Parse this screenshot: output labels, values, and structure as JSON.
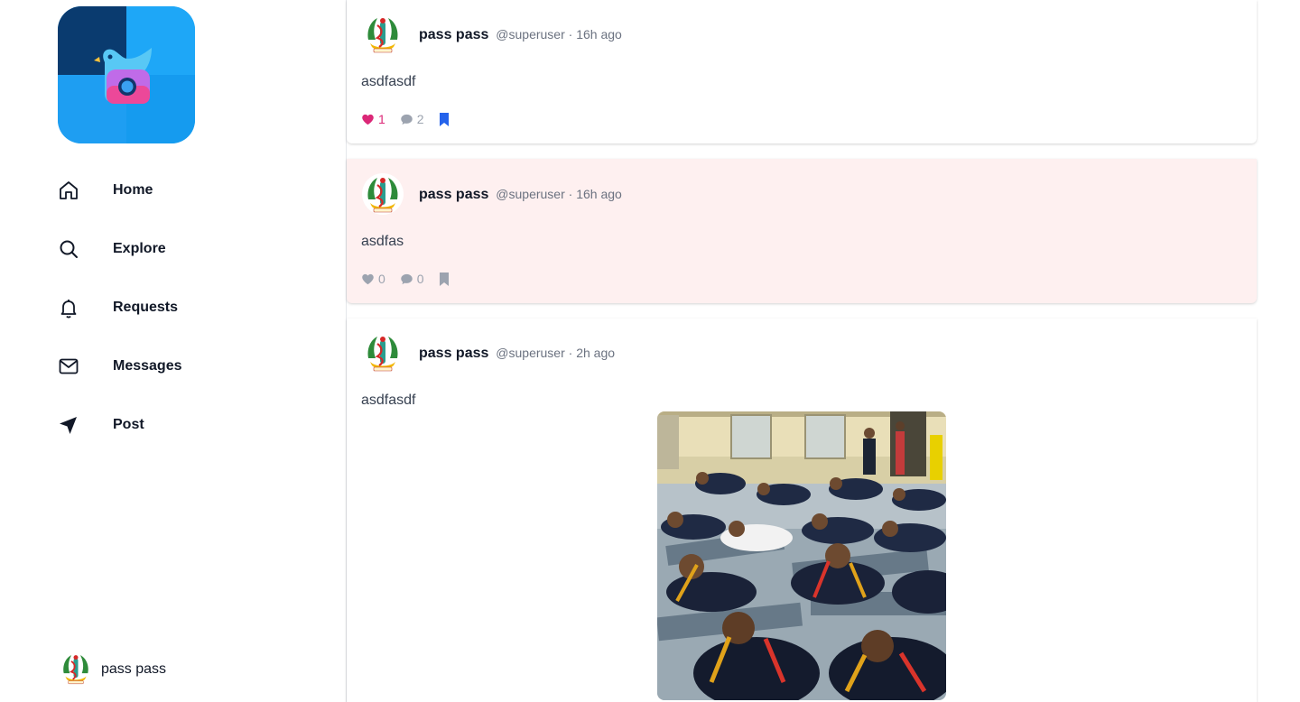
{
  "sidebar": {
    "nav": [
      {
        "label": "Home",
        "icon": "home-icon"
      },
      {
        "label": "Explore",
        "icon": "search-icon"
      },
      {
        "label": "Requests",
        "icon": "bell-icon"
      },
      {
        "label": "Messages",
        "icon": "mail-icon"
      },
      {
        "label": "Post",
        "icon": "send-icon"
      }
    ],
    "profile": {
      "name": "pass pass"
    }
  },
  "posts": [
    {
      "name": "pass pass",
      "handle": "@superuser",
      "time": "· 16h ago",
      "text": "asdfasdf",
      "likes": "1",
      "comments": "2",
      "liked": true,
      "bookmarked": true
    },
    {
      "name": "pass pass",
      "handle": "@superuser",
      "time": "· 16h ago",
      "text": "asdfas",
      "likes": "0",
      "comments": "0",
      "liked": false,
      "bookmarked": false
    },
    {
      "name": "pass pass",
      "handle": "@superuser",
      "time": "· 2h ago",
      "text": "asdfasdf",
      "image": "group-exercise-photo"
    }
  ],
  "colors": {
    "accent_blue": "#1d9bf0",
    "like_pink": "#db2777",
    "bookmark_blue": "#2563eb",
    "highlight_bg": "#fef0f0",
    "muted": "#9ca3af"
  }
}
